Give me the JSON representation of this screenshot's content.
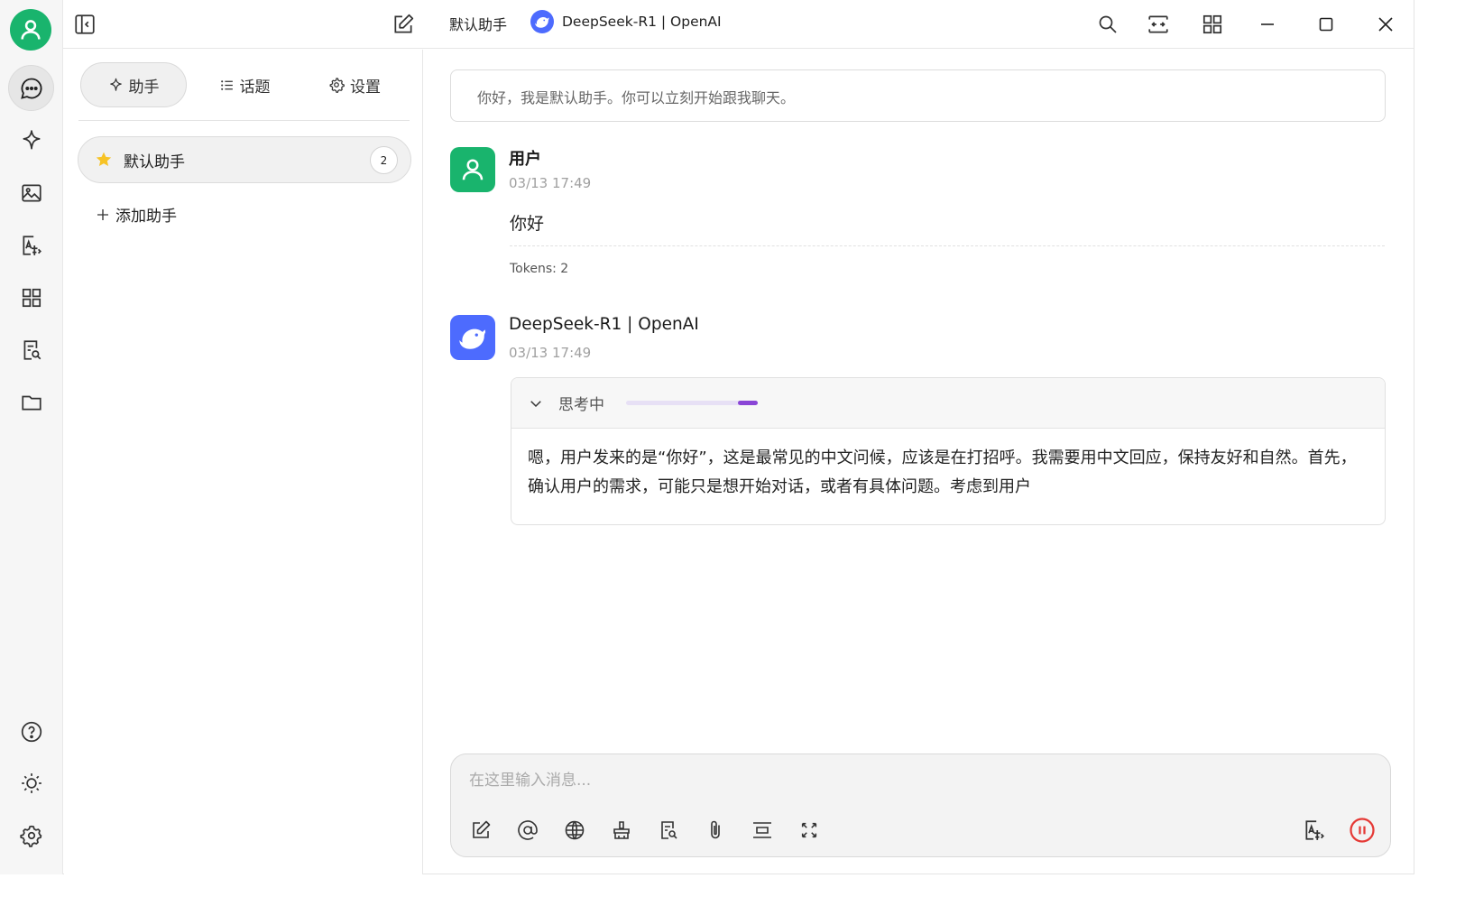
{
  "topbar": {
    "assistant_title": "默认助手",
    "model_name": "DeepSeek-R1 | OpenAI"
  },
  "sidebar": {
    "tabs": [
      {
        "label": "助手",
        "icon": "sparkle-icon",
        "active": true
      },
      {
        "label": "话题",
        "icon": "list-icon",
        "active": false
      },
      {
        "label": "设置",
        "icon": "gear-icon",
        "active": false
      }
    ],
    "assistants": [
      {
        "name": "默认助手",
        "emoji": "star",
        "count": "2"
      }
    ],
    "add_assistant_label": "添加助手"
  },
  "chat": {
    "prompt_text": "你好，我是默认助手。你可以立刻开始跟我聊天。",
    "messages": [
      {
        "role": "user",
        "name": "用户",
        "time": "03/13 17:49",
        "text": "你好",
        "tokens": "Tokens: 2"
      },
      {
        "role": "assistant",
        "name": "DeepSeek-R1 | OpenAI",
        "time": "03/13 17:49",
        "thinking_label": "思考中",
        "thinking_progress": 0.15,
        "thinking_text": "嗯，用户发来的是“你好”，这是最常见的中文问候，应该是在打招呼。我需要用中文回应，保持友好和自然。首先，确认用户的需求，可能只是想开始对话，或者有具体问题。考虑到用户"
      }
    ]
  },
  "composer": {
    "placeholder": "在这里输入消息...",
    "value": ""
  },
  "colors": {
    "user_avatar": "#19b46d",
    "model_brand": "#4d6bfe",
    "thinking_accent": "#8a45d6",
    "stop_button": "#e53935"
  }
}
